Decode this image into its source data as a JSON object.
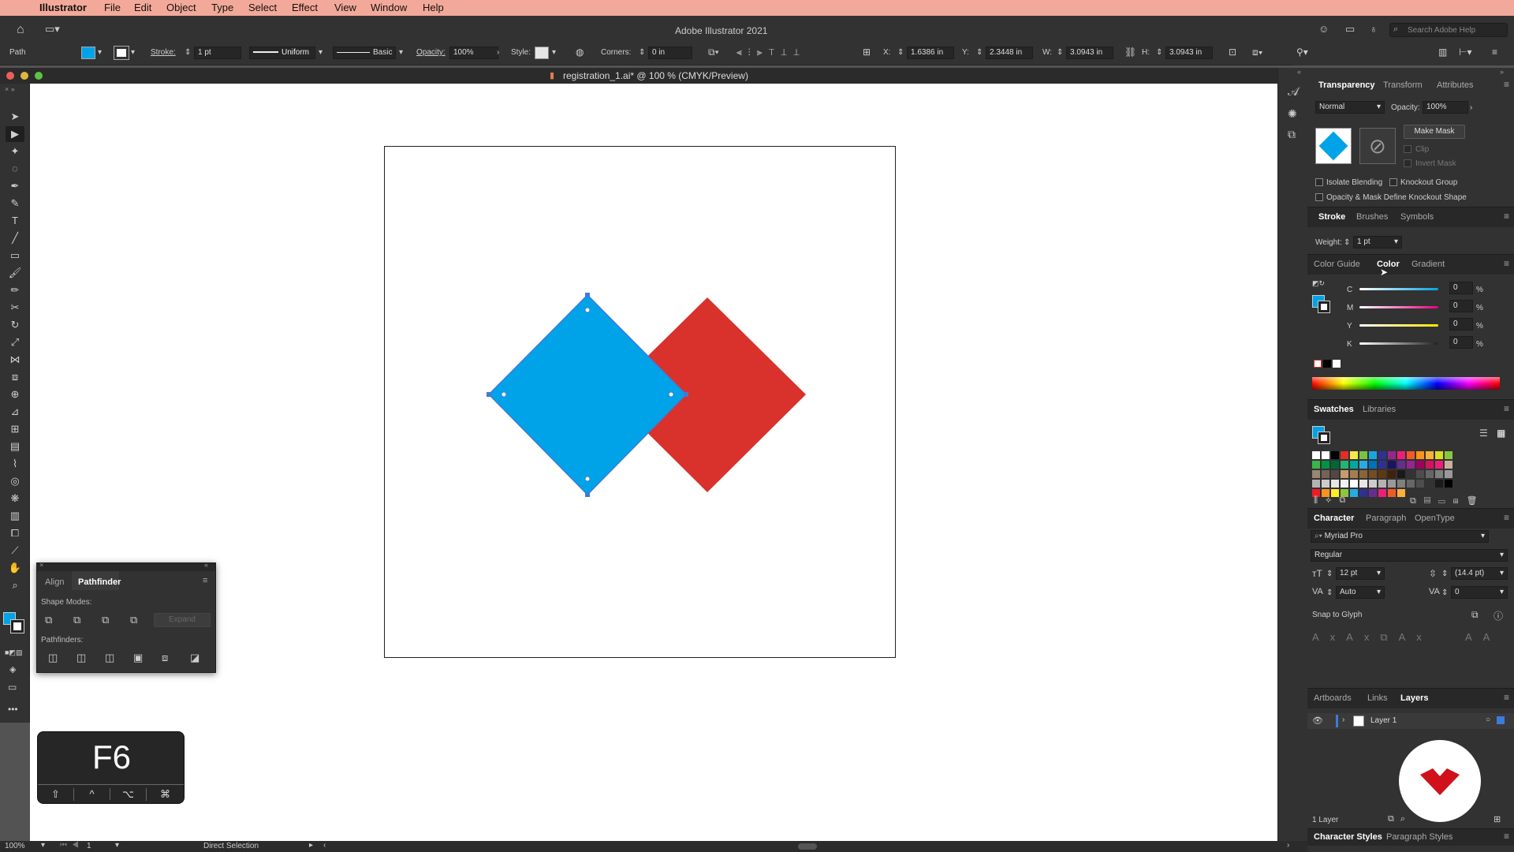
{
  "menubar": {
    "apple": "",
    "app": "Illustrator",
    "items": [
      "File",
      "Edit",
      "Object",
      "Type",
      "Select",
      "Effect",
      "View",
      "Window",
      "Help"
    ]
  },
  "title": "Adobe Illustrator 2021",
  "search_placeholder": "Search Adobe Help",
  "control": {
    "selection": "Path",
    "stroke_label": "Stroke:",
    "stroke_value": "1 pt",
    "uniform": "Uniform",
    "basic": "Basic",
    "opacity_label": "Opacity:",
    "opacity_value": "100%",
    "style_label": "Style:",
    "corners_label": "Corners:",
    "corners_value": "0 in",
    "x_label": "X:",
    "x_value": "1.6386 in",
    "y_label": "Y:",
    "y_value": "2.3448 in",
    "w_label": "W:",
    "w_value": "3.0943 in",
    "h_label": "H:",
    "h_value": "3.0943 in"
  },
  "document_tab": "registration_1.ai* @ 100 % (CMYK/Preview)",
  "transparency": {
    "tabs": [
      "Transparency",
      "Transform",
      "Attributes"
    ],
    "blend": "Normal",
    "opacity_label": "Opacity:",
    "opacity": "100%",
    "make_mask": "Make Mask",
    "clip": "Clip",
    "invert_mask": "Invert Mask",
    "isolate": "Isolate Blending",
    "knockout": "Knockout Group",
    "opacity_mask": "Opacity & Mask Define Knockout Shape"
  },
  "stroke": {
    "tabs": [
      "Stroke",
      "Brushes",
      "Symbols"
    ],
    "weight_label": "Weight:",
    "weight": "1 pt"
  },
  "color": {
    "tabs": [
      "Color Guide",
      "Color",
      "Gradient"
    ],
    "channels": [
      {
        "k": "C",
        "v": "0",
        "c": "#00a4e4"
      },
      {
        "k": "M",
        "v": "0",
        "c": "#e5007e"
      },
      {
        "k": "Y",
        "v": "0",
        "c": "#ffe600"
      },
      {
        "k": "K",
        "v": "0",
        "c": "#222222"
      }
    ],
    "pct": "%"
  },
  "swatches": {
    "tabs": [
      "Swatches",
      "Libraries"
    ]
  },
  "character": {
    "tabs": [
      "Character",
      "Paragraph",
      "OpenType"
    ],
    "font": "Myriad Pro",
    "style": "Regular",
    "size": "12 pt",
    "leading": "(14.4 pt)",
    "kerning": "Auto",
    "tracking": "0",
    "snap": "Snap to Glyph"
  },
  "layers": {
    "tabs": [
      "Artboards",
      "Links",
      "Layers"
    ],
    "layer_name": "Layer 1",
    "count": "1 Layer"
  },
  "bottom_tabs": [
    "Character Styles",
    "Paragraph Styles"
  ],
  "pathfinder": {
    "tabs": [
      "Align",
      "Pathfinder"
    ],
    "shape_modes": "Shape Modes:",
    "expand": "Expand",
    "pathfinders": "Pathfinders:"
  },
  "keycap": {
    "key": "F6",
    "mods": [
      "⇧",
      "^",
      "⌥",
      "⌘"
    ]
  },
  "status": {
    "zoom": "100%",
    "page": "1",
    "tool": "Direct Selection"
  },
  "colors": {
    "blue": "#00a3e8",
    "red": "#d9312b",
    "selection": "#3d7bd9"
  }
}
